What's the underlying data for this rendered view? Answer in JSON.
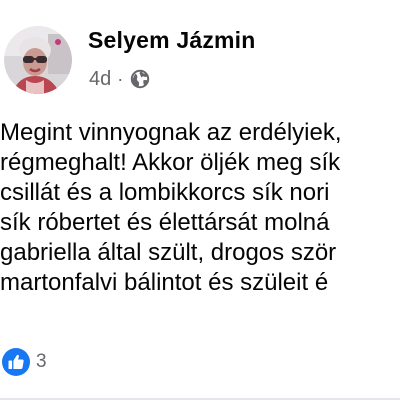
{
  "post": {
    "author": "Selyem Jázmin",
    "time": "4d",
    "separator": "·",
    "privacy_icon": "globe-icon",
    "avatar_icon": "profile-photo-avatar",
    "text_lines": [
      "Megint vinnyognak az erdélyiek,",
      "régmeghalt! Akkor öljék meg sík",
      "csillát és a lombikkorcs sík nori",
      "sík róbertet és élettársát molná",
      "gabriella által szült, drogos ször",
      "martonfalvi bálintot és szüleit é"
    ],
    "reactions": {
      "icon": "like-icon",
      "count": "3"
    }
  },
  "colors": {
    "name": "#050505",
    "meta": "#65676b",
    "like_blue": "#1877f2"
  }
}
